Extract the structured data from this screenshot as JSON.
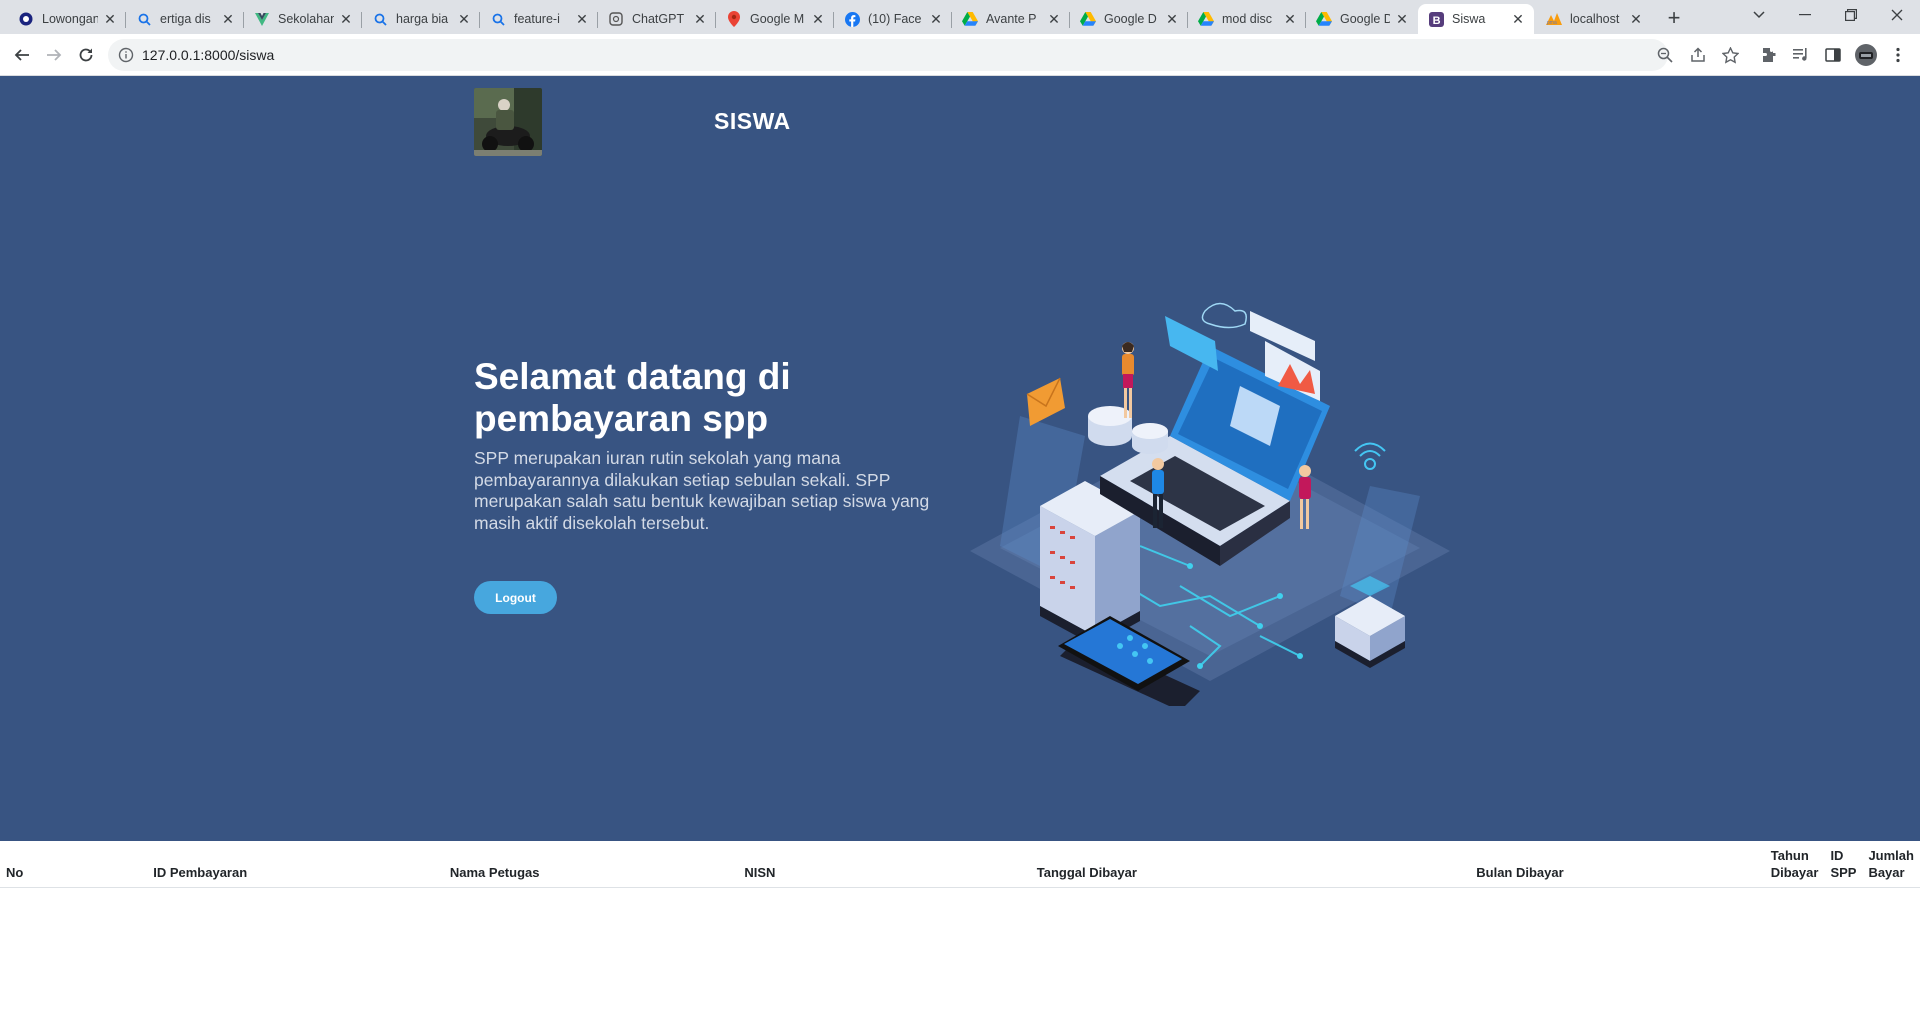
{
  "browser": {
    "tabs": [
      {
        "title": "Lowongan",
        "favicon": "globe-icon",
        "active": false
      },
      {
        "title": "ertiga dis",
        "favicon": "search-icon",
        "active": false
      },
      {
        "title": "Sekolahan",
        "favicon": "vue-icon",
        "active": false
      },
      {
        "title": "harga bia",
        "favicon": "search-icon",
        "active": false
      },
      {
        "title": "feature-i",
        "favicon": "search-icon",
        "active": false
      },
      {
        "title": "ChatGPT",
        "favicon": "chatgpt-icon",
        "active": false
      },
      {
        "title": "Google M",
        "favicon": "maps-icon",
        "active": false
      },
      {
        "title": "(10) Face",
        "favicon": "facebook-icon",
        "active": false
      },
      {
        "title": "Avante P",
        "favicon": "drive-icon",
        "active": false
      },
      {
        "title": "Google D",
        "favicon": "drive-icon",
        "active": false
      },
      {
        "title": "mod disc",
        "favicon": "drive-icon",
        "active": false
      },
      {
        "title": "Google D",
        "favicon": "drive-icon",
        "active": false
      },
      {
        "title": "Siswa",
        "favicon": "bootstrap-icon",
        "active": true
      },
      {
        "title": "localhost",
        "favicon": "phpmyadmin-icon",
        "active": false
      }
    ],
    "url": "127.0.0.1:8000/siswa"
  },
  "header": {
    "brand": "SISWA"
  },
  "hero": {
    "headline": "Selamat datang di pembayaran spp",
    "description": "SPP merupakan iuran rutin sekolah yang mana pembayarannya dilakukan setiap sebulan sekali. SPP merupakan salah satu bentuk kewajiban setiap siswa yang masih aktif disekolah tersebut.",
    "logout_label": "Logout"
  },
  "table": {
    "headers": [
      "No",
      "ID Pembayaran",
      "Nama Petugas",
      "NISN",
      "Tanggal Dibayar",
      "Bulan Dibayar",
      "Tahun Dibayar",
      "ID SPP",
      "Jumlah Bayar"
    ],
    "rows": []
  },
  "colors": {
    "hero_bg": "#385482",
    "button_bg": "#47a7de"
  }
}
